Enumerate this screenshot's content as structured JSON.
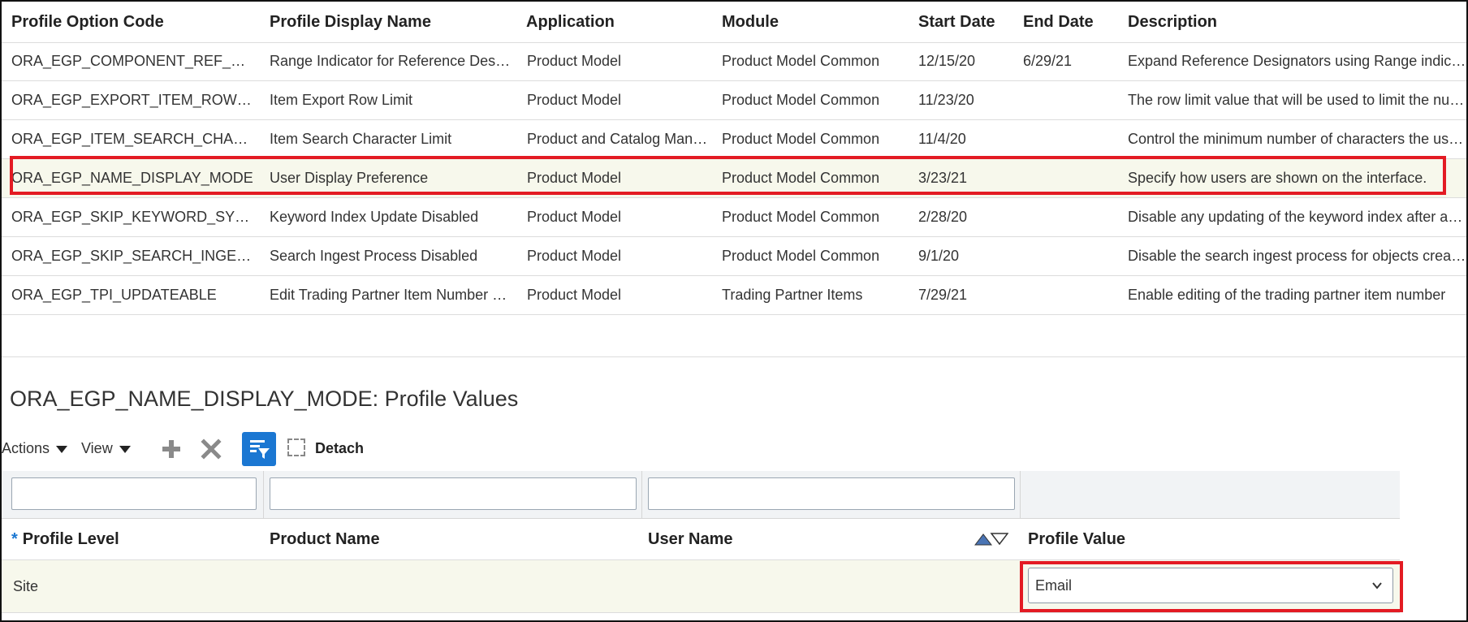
{
  "top_table": {
    "columns": [
      "Profile Option Code",
      "Profile Display Name",
      "Application",
      "Module",
      "Start Date",
      "End Date",
      "Description"
    ],
    "rows": [
      [
        "ORA_EGP_COMPONENT_REF_DESIGNATOR_RANGE",
        "Range Indicator for Reference Designators",
        "Product Model",
        "Product Model Common",
        "12/15/20",
        "6/29/21",
        "Expand Reference Designators using Range indicator"
      ],
      [
        "ORA_EGP_EXPORT_ITEM_ROW_LIMIT",
        "Item Export Row Limit",
        "Product Model",
        "Product Model Common",
        "11/23/20",
        "",
        "The row limit value that will be used to limit the number of rows exported"
      ],
      [
        "ORA_EGP_ITEM_SEARCH_CHARACTER_LIMIT",
        "Item Search Character Limit",
        "Product and Catalog Management",
        "Product Model Common",
        "11/4/20",
        "",
        "Control the minimum number of characters the user must enter"
      ],
      [
        "ORA_EGP_NAME_DISPLAY_MODE",
        "User Display Preference",
        "Product Model",
        "Product Model Common",
        "3/23/21",
        "",
        "Specify how users are shown on the interface."
      ],
      [
        "ORA_EGP_SKIP_KEYWORD_SYNC",
        "Keyword Index Update Disabled",
        "Product Model",
        "Product Model Common",
        "2/28/20",
        "",
        "Disable any updating of the keyword index after an update"
      ],
      [
        "ORA_EGP_SKIP_SEARCH_INGEST",
        "Search Ingest Process Disabled",
        "Product Model",
        "Product Model Common",
        "9/1/20",
        "",
        "Disable the search ingest process for objects created"
      ],
      [
        "ORA_EGP_TPI_UPDATEABLE",
        "Edit Trading Partner Item Number Enabled",
        "Product Model",
        "Trading Partner Items",
        "7/29/21",
        "",
        "Enable editing of the trading partner item number"
      ]
    ],
    "selected_row": 3
  },
  "section_title": "ORA_EGP_NAME_DISPLAY_MODE: Profile Values",
  "toolbar": {
    "actions_label": "Actions",
    "view_label": "View",
    "add_icon": "plus-icon",
    "delete_icon": "x-icon",
    "filter_icon": "query-by-example-icon",
    "detach_label": "Detach"
  },
  "lower_table": {
    "required_marker": "*",
    "columns": [
      "Profile Level",
      "Product Name",
      "User Name",
      "Profile Value"
    ],
    "rows": [
      {
        "profile_level": "Site",
        "product_name": "",
        "user_name": "",
        "profile_value": "Email"
      }
    ]
  },
  "colors": {
    "highlight": "#e31b23",
    "selected_row_bg": "#f7f8ec",
    "accent": "#1b77d2"
  }
}
